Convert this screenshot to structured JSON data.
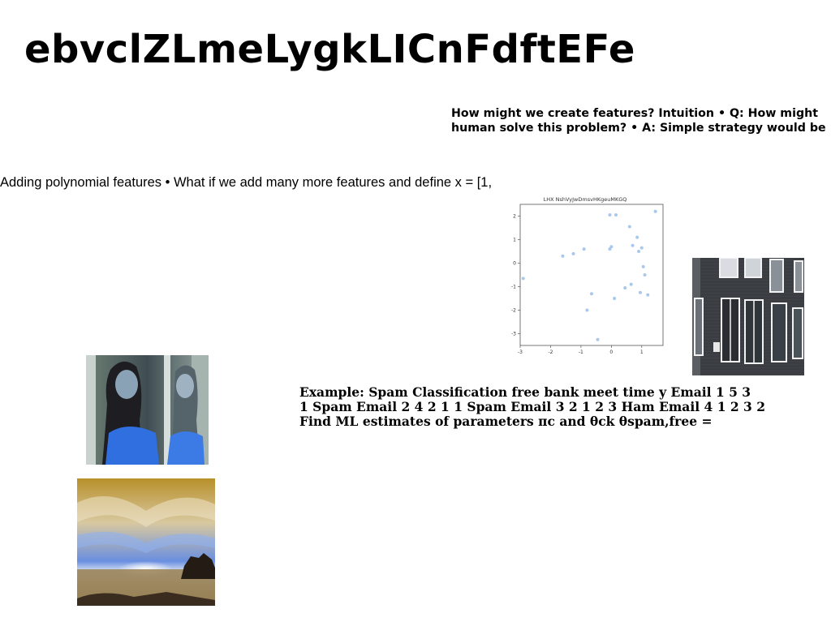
{
  "slide": {
    "title": "ebvclZLmeLygkLICnFdftEFe",
    "features_note": "How might we create features? Intuition • Q: How might\nhuman solve this problem? • A: Simple strategy would be",
    "polynomial_note": "Adding polynomial features • What if we add many more features and define x = [1,",
    "spam_example": "Example: Spam Classification free bank meet time y Email 1 5 3\n1 Spam Email 2 4 2 1 1 Spam Email 3 2 1 2 3 Ham Email 4 1 2 3 2\nFind ML estimates of parameters πc and θck θspam,free ="
  },
  "images": {
    "building": "building-photo",
    "woman": "woman-mirror-photo",
    "sunset": "sunset-beach-photo"
  },
  "chart_data": {
    "type": "scatter",
    "title": "LHX NshVyJwDmsvHKgeuMKGQ",
    "xlabel": "",
    "ylabel": "",
    "xlim": [
      -3.0,
      1.7
    ],
    "ylim": [
      -3.5,
      2.5
    ],
    "xticks": [
      -3,
      -2,
      -1,
      0,
      1
    ],
    "yticks": [
      -3,
      -2,
      -1,
      0,
      1,
      2
    ],
    "grid": false,
    "point_color": "#a9c8ec",
    "x": [
      -2.9,
      -1.6,
      -1.25,
      -0.9,
      -0.8,
      -0.65,
      -0.45,
      -0.05,
      -0.05,
      0.0,
      0.1,
      0.15,
      0.45,
      0.6,
      0.65,
      0.7,
      0.85,
      0.9,
      0.95,
      1.0,
      1.05,
      1.1,
      1.2,
      1.45
    ],
    "y": [
      -0.65,
      0.3,
      0.4,
      0.6,
      -2.0,
      -1.3,
      -3.25,
      2.05,
      0.6,
      0.7,
      -1.5,
      2.05,
      -1.05,
      1.55,
      -0.9,
      0.75,
      1.1,
      0.5,
      -1.25,
      0.65,
      -0.15,
      -0.5,
      -1.35,
      2.2
    ]
  }
}
